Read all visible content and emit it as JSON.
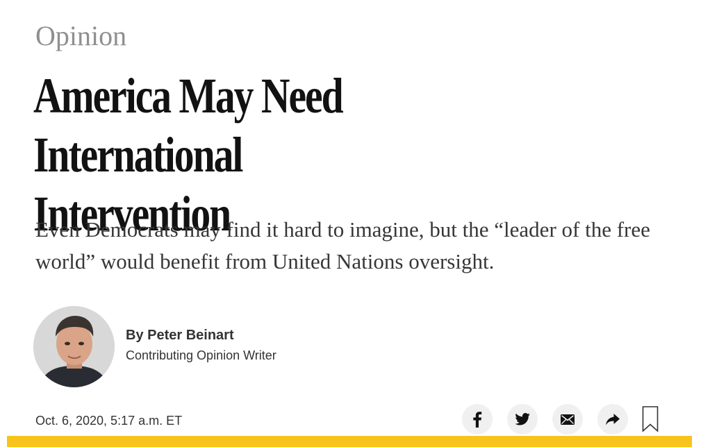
{
  "section": {
    "label": "Opinion"
  },
  "article": {
    "headline_line1": "America May Need International",
    "headline_line2": "Intervention",
    "summary": "Even Democrats may find it hard to imagine, but the “leader of the free world” would benefit from United Nations oversight."
  },
  "byline": {
    "name": "By Peter Beinart",
    "role": "Contributing Opinion Writer"
  },
  "meta": {
    "timestamp": "Oct. 6, 2020, 5:17 a.m. ET"
  },
  "share": {
    "icons": [
      "facebook-icon",
      "twitter-icon",
      "email-icon",
      "share-arrow-icon",
      "bookmark-icon"
    ],
    "button_bg": "#f0f0f0",
    "icon_color": "#121212"
  },
  "colors": {
    "section_label": "#8f8f8f",
    "headline": "#121212",
    "summary": "#363636",
    "accent_bar": "#f8c31c"
  }
}
